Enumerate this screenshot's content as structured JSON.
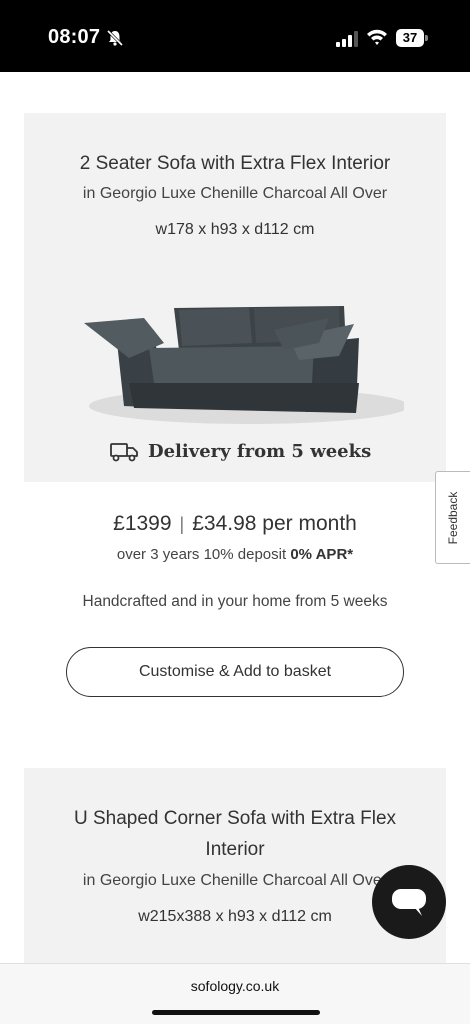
{
  "status_bar": {
    "time": "08:07",
    "battery": "37"
  },
  "product_1": {
    "title": "2 Seater Sofa with Extra Flex Interior",
    "fabric": "in Georgio Luxe Chenille Charcoal All Over",
    "dimensions": "w178 x h93 x d112 cm",
    "delivery": "Delivery from 5 weeks",
    "price": "£1399",
    "monthly": "£34.98 per month",
    "finance_terms": "over 3 years 10% deposit",
    "apr": "0% APR*",
    "handcrafted": "Handcrafted and in your home from 5 weeks",
    "cta": "Customise & Add to basket"
  },
  "product_2": {
    "title_line1": "U Shaped Corner Sofa with Extra Flex",
    "title_line2": "Interior",
    "fabric": "in Georgio Luxe Chenille Charcoal All Over",
    "dimensions": "w215x388 x h93 x d112 cm"
  },
  "feedback": {
    "label": "Feedback"
  },
  "browser": {
    "url": "sofology.co.uk"
  },
  "colors": {
    "card_bg": "#f2f2f2",
    "text": "#333333",
    "chat_button": "#1a1a1a"
  }
}
